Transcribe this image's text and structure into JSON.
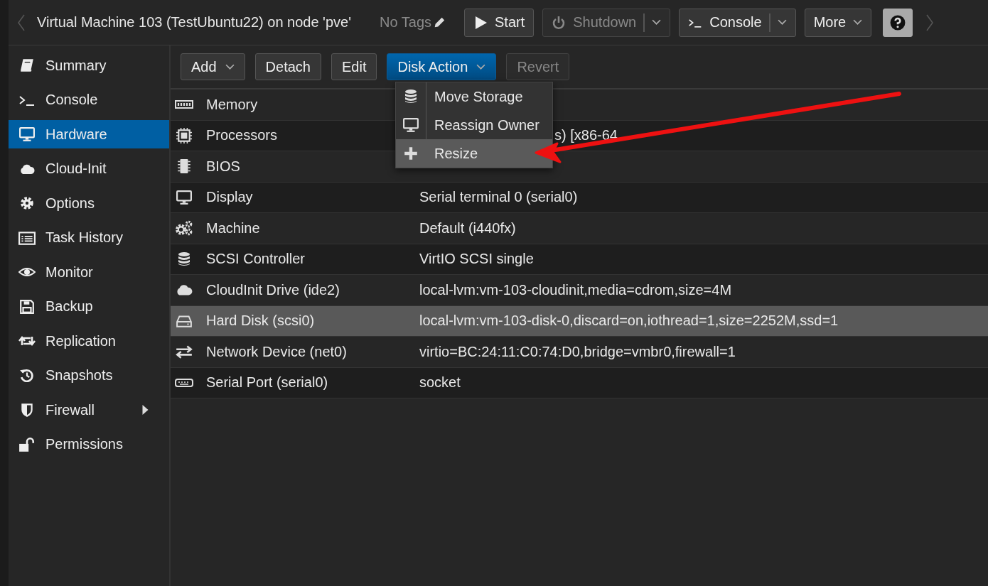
{
  "header": {
    "title": "Virtual Machine 103 (TestUbuntu22) on node 'pve'",
    "tags": "No Tags",
    "buttons": [
      {
        "label": "Start",
        "kind": "play",
        "disabled": false
      },
      {
        "label": "Shutdown",
        "kind": "power",
        "disabled": true,
        "split": true
      },
      {
        "label": "Console",
        "kind": "terminal",
        "disabled": false,
        "split": true
      },
      {
        "label": "More",
        "kind": "plain",
        "disabled": false,
        "dropdown": true
      },
      {
        "kind": "help",
        "disabled": false
      }
    ]
  },
  "sidebar": {
    "items": [
      {
        "label": "Summary",
        "kind": "book",
        "selected": false
      },
      {
        "label": "Console",
        "kind": "terminal",
        "selected": false
      },
      {
        "label": "Hardware",
        "kind": "desktop",
        "selected": true
      },
      {
        "label": "Cloud-Init",
        "kind": "cloud",
        "selected": false
      },
      {
        "label": "Options",
        "kind": "gear",
        "selected": false
      },
      {
        "label": "Task History",
        "kind": "list",
        "selected": false
      },
      {
        "label": "Monitor",
        "kind": "eye",
        "selected": false
      },
      {
        "label": "Backup",
        "kind": "floppy",
        "selected": false
      },
      {
        "label": "Replication",
        "kind": "retweet",
        "selected": false
      },
      {
        "label": "Snapshots",
        "kind": "history",
        "selected": false
      },
      {
        "label": "Firewall",
        "kind": "shield",
        "selected": false,
        "expandable": true
      },
      {
        "label": "Permissions",
        "kind": "unlock",
        "selected": false
      }
    ]
  },
  "toolbar": {
    "buttons": [
      {
        "label": "Add",
        "dropdown": true,
        "pressed": false,
        "disabled": false
      },
      {
        "label": "Detach",
        "pressed": false,
        "disabled": false
      },
      {
        "label": "Edit",
        "pressed": false,
        "disabled": false
      },
      {
        "label": "Disk Action",
        "dropdown": true,
        "pressed": true,
        "disabled": false
      },
      {
        "label": "Revert",
        "pressed": false,
        "disabled": true
      }
    ]
  },
  "table": {
    "rows": [
      {
        "name": "Memory",
        "kind": "memory",
        "selected": false
      },
      {
        "name": "Processors",
        "kind": "cpu",
        "value": "s) [x86-64",
        "selected": false,
        "clipped_left": true
      },
      {
        "name": "BIOS",
        "kind": "chip",
        "selected": false
      },
      {
        "name": "Display",
        "kind": "desktop",
        "value": "Serial terminal 0 (serial0)",
        "selected": false
      },
      {
        "name": "Machine",
        "kind": "gears",
        "value": "Default (i440fx)",
        "selected": false
      },
      {
        "name": "SCSI Controller",
        "kind": "database",
        "value": "VirtIO SCSI single",
        "selected": false
      },
      {
        "name": "CloudInit Drive (ide2)",
        "kind": "cloud",
        "value": "local-lvm:vm-103-cloudinit,media=cdrom,size=4M",
        "selected": false
      },
      {
        "name": "Hard Disk (scsi0)",
        "kind": "hdd",
        "value": "local-lvm:vm-103-disk-0,discard=on,iothread=1,size=2252M,ssd=1",
        "selected": true
      },
      {
        "name": "Network Device (net0)",
        "kind": "exchange",
        "value": "virtio=BC:24:11:C0:74:D0,bridge=vmbr0,firewall=1",
        "selected": false
      },
      {
        "name": "Serial Port (serial0)",
        "kind": "keyboard",
        "value": "socket",
        "selected": false
      }
    ]
  },
  "menu": {
    "items": [
      {
        "label": "Move Storage",
        "kind": "database",
        "selected": false
      },
      {
        "label": "Reassign Owner",
        "kind": "desktop",
        "selected": false
      },
      {
        "label": "Resize",
        "kind": "plus",
        "selected": true
      }
    ]
  },
  "annotation": {
    "kind": "arrow"
  }
}
